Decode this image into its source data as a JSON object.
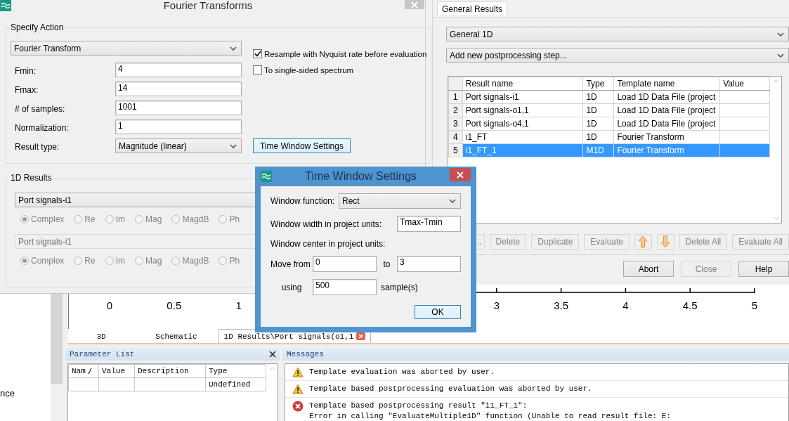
{
  "fourier_dialog": {
    "title": "Fourier Transforms",
    "specify_action": {
      "legend": "Specify Action",
      "action": "Fourier Transform",
      "fields": [
        {
          "label": "Fmin:",
          "value": "4"
        },
        {
          "label": "Fmax:",
          "value": "14"
        },
        {
          "label": "# of samples:",
          "value": "1001"
        },
        {
          "label": "Normalization:",
          "value": "1"
        }
      ],
      "result_type": {
        "label": "Result type:",
        "value": "Magnitude (linear)"
      },
      "options": [
        {
          "label": "Resample with Nyquist rate before evaluation",
          "checked": true
        },
        {
          "label": "To single-sided spectrum",
          "checked": false
        }
      ],
      "time_window_button": "Time Window Settings"
    },
    "results_1d": {
      "legend": "1D Results",
      "groups": [
        {
          "signal": "Port signals-i1",
          "disabled": false,
          "modes": [
            {
              "label": "Complex",
              "selected": true
            },
            {
              "label": "Re",
              "selected": false
            },
            {
              "label": "Im",
              "selected": false
            },
            {
              "label": "Mag",
              "selected": false
            },
            {
              "label": "MagdB",
              "selected": false
            },
            {
              "label": "Ph",
              "selected": false
            }
          ]
        },
        {
          "signal": "Port signals-i1",
          "disabled": true,
          "modes": [
            {
              "label": "Complex",
              "selected": true
            },
            {
              "label": "Re",
              "selected": false
            },
            {
              "label": "Im",
              "selected": false
            },
            {
              "label": "Mag",
              "selected": false
            },
            {
              "label": "MagdB",
              "selected": false
            },
            {
              "label": "Ph",
              "selected": false
            }
          ]
        }
      ]
    }
  },
  "general_results": {
    "tab": "General Results",
    "category": "General 1D",
    "add_step": "Add new postprocessing step...",
    "columns": [
      "Result name",
      "Type",
      "Template name",
      "Value"
    ],
    "rows": [
      {
        "index": "1",
        "name": "Port signals-i1",
        "type": "1D",
        "template": "Load 1D Data File (project",
        "selected": false
      },
      {
        "index": "2",
        "name": "Port signals-o1,1",
        "type": "1D",
        "template": "Load 1D Data File (project",
        "selected": false
      },
      {
        "index": "3",
        "name": "Port signals-o4,1",
        "type": "1D",
        "template": "Load 1D Data File (project",
        "selected": false
      },
      {
        "index": "4",
        "name": "i1_FT",
        "type": "1D",
        "template": "Fourier Transform",
        "selected": false
      },
      {
        "index": "5",
        "name": "i1_FT_1",
        "type": "M1D",
        "template": "Fourier Transform",
        "selected": true
      }
    ],
    "tools": [
      {
        "kind": "text",
        "label": "..",
        "disabled": true
      },
      {
        "kind": "text",
        "label": "Delete",
        "disabled": true
      },
      {
        "kind": "text",
        "label": "Duplicate",
        "disabled": true
      },
      {
        "kind": "text",
        "label": "Evaluate",
        "disabled": true
      },
      {
        "kind": "up",
        "disabled": true
      },
      {
        "kind": "down",
        "disabled": true
      },
      {
        "kind": "text",
        "label": "Delete All",
        "disabled": true
      },
      {
        "kind": "text",
        "label": "Evaluate All",
        "disabled": true
      }
    ],
    "actions": [
      {
        "label": "Abort",
        "disabled": false
      },
      {
        "label": "Close",
        "disabled": true
      },
      {
        "label": "Help",
        "disabled": false
      }
    ]
  },
  "time_window": {
    "title": "Time Window Settings",
    "function_label": "Window function:",
    "function": "Rect",
    "width_label": "Window width in project units:",
    "width": "Tmax-Tmin",
    "center_label": "Window center in project units:",
    "from_label": "Move from",
    "from": "0",
    "to_label": "to",
    "to": "3",
    "using_label": "using",
    "samples": "500",
    "samples_unit": "sample(s)",
    "ok": "OK"
  },
  "plot": {
    "ticks": [
      "0",
      "0.5",
      "1",
      "3",
      "3.5",
      "4",
      "4.5",
      "5"
    ]
  },
  "view_tabs": [
    {
      "label": "3D",
      "selected": false
    },
    {
      "label": "Schematic",
      "selected": false
    },
    {
      "label": "1D Results\\Port signals(o1,1",
      "selected": true
    }
  ],
  "left_panel": {
    "text": "nce"
  },
  "parameter_list": {
    "title": "Parameter List",
    "columns": [
      "Nam",
      "Value",
      "Description",
      "Type"
    ],
    "rows": [
      {
        "type": "Undefined"
      }
    ]
  },
  "messages": {
    "title": "Messages",
    "items": [
      {
        "kind": "warning",
        "text": "Template evaluation was aborted by user."
      },
      {
        "kind": "warning",
        "text": "Template based postprocessing evaluation was aborted by user."
      },
      {
        "kind": "error",
        "text": "Template based postprocessing result \"i1_FT_1\":\nError in calling \"EvaluateMultiple1D\" function (Unable to read result file: E:"
      }
    ]
  }
}
